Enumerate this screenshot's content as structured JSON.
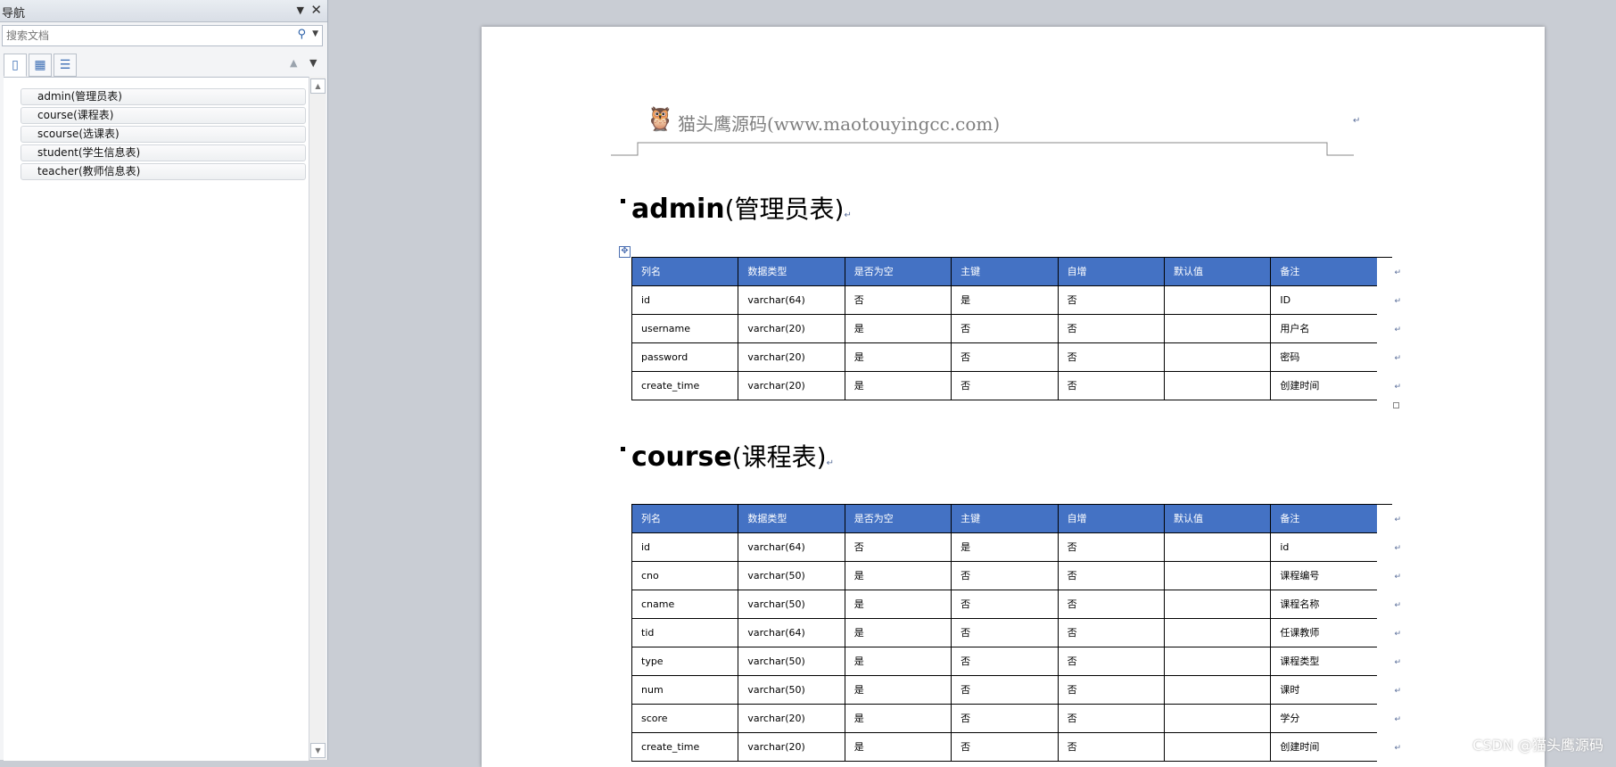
{
  "nav": {
    "title": "导航",
    "search_placeholder": "搜索文档",
    "items": [
      {
        "label": "admin(管理员表)",
        "selected": true
      },
      {
        "label": "course(课程表)",
        "selected": false
      },
      {
        "label": "scourse(选课表)",
        "selected": false
      },
      {
        "label": "student(学生信息表)",
        "selected": false
      },
      {
        "label": "teacher(教师信息表)",
        "selected": false
      }
    ]
  },
  "doc": {
    "header_text": "猫头鹰源码(www.maotouyingcc.com)",
    "para_mark": "↵",
    "sections": [
      {
        "heading_en": "admin",
        "heading_cn": "(管理员表)",
        "columns": [
          "列名",
          "数据类型",
          "是否为空",
          "主键",
          "自增",
          "默认值",
          "备注"
        ],
        "rows": [
          [
            "id",
            "varchar(64)",
            "否",
            "是",
            "否",
            "",
            "ID"
          ],
          [
            "username",
            "varchar(20)",
            "是",
            "否",
            "否",
            "",
            "用户名"
          ],
          [
            "password",
            "varchar(20)",
            "是",
            "否",
            "否",
            "",
            "密码"
          ],
          [
            "create_time",
            "varchar(20)",
            "是",
            "否",
            "否",
            "",
            "创建时间"
          ]
        ]
      },
      {
        "heading_en": "course",
        "heading_cn": "(课程表)",
        "columns": [
          "列名",
          "数据类型",
          "是否为空",
          "主键",
          "自增",
          "默认值",
          "备注"
        ],
        "rows": [
          [
            "id",
            "varchar(64)",
            "否",
            "是",
            "否",
            "",
            "id"
          ],
          [
            "cno",
            "varchar(50)",
            "是",
            "否",
            "否",
            "",
            "课程编号"
          ],
          [
            "cname",
            "varchar(50)",
            "是",
            "否",
            "否",
            "",
            "课程名称"
          ],
          [
            "tid",
            "varchar(64)",
            "是",
            "否",
            "否",
            "",
            "任课教师"
          ],
          [
            "type",
            "varchar(50)",
            "是",
            "否",
            "否",
            "",
            "课程类型"
          ],
          [
            "num",
            "varchar(50)",
            "是",
            "否",
            "否",
            "",
            "课时"
          ],
          [
            "score",
            "varchar(20)",
            "是",
            "否",
            "否",
            "",
            "学分"
          ],
          [
            "create_time",
            "varchar(20)",
            "是",
            "否",
            "否",
            "",
            "创建时间"
          ]
        ]
      }
    ]
  },
  "watermark": "CSDN @猫头鹰源码",
  "colors": {
    "table_header": "#4472c4",
    "nav_selected": "#fcd35e"
  }
}
